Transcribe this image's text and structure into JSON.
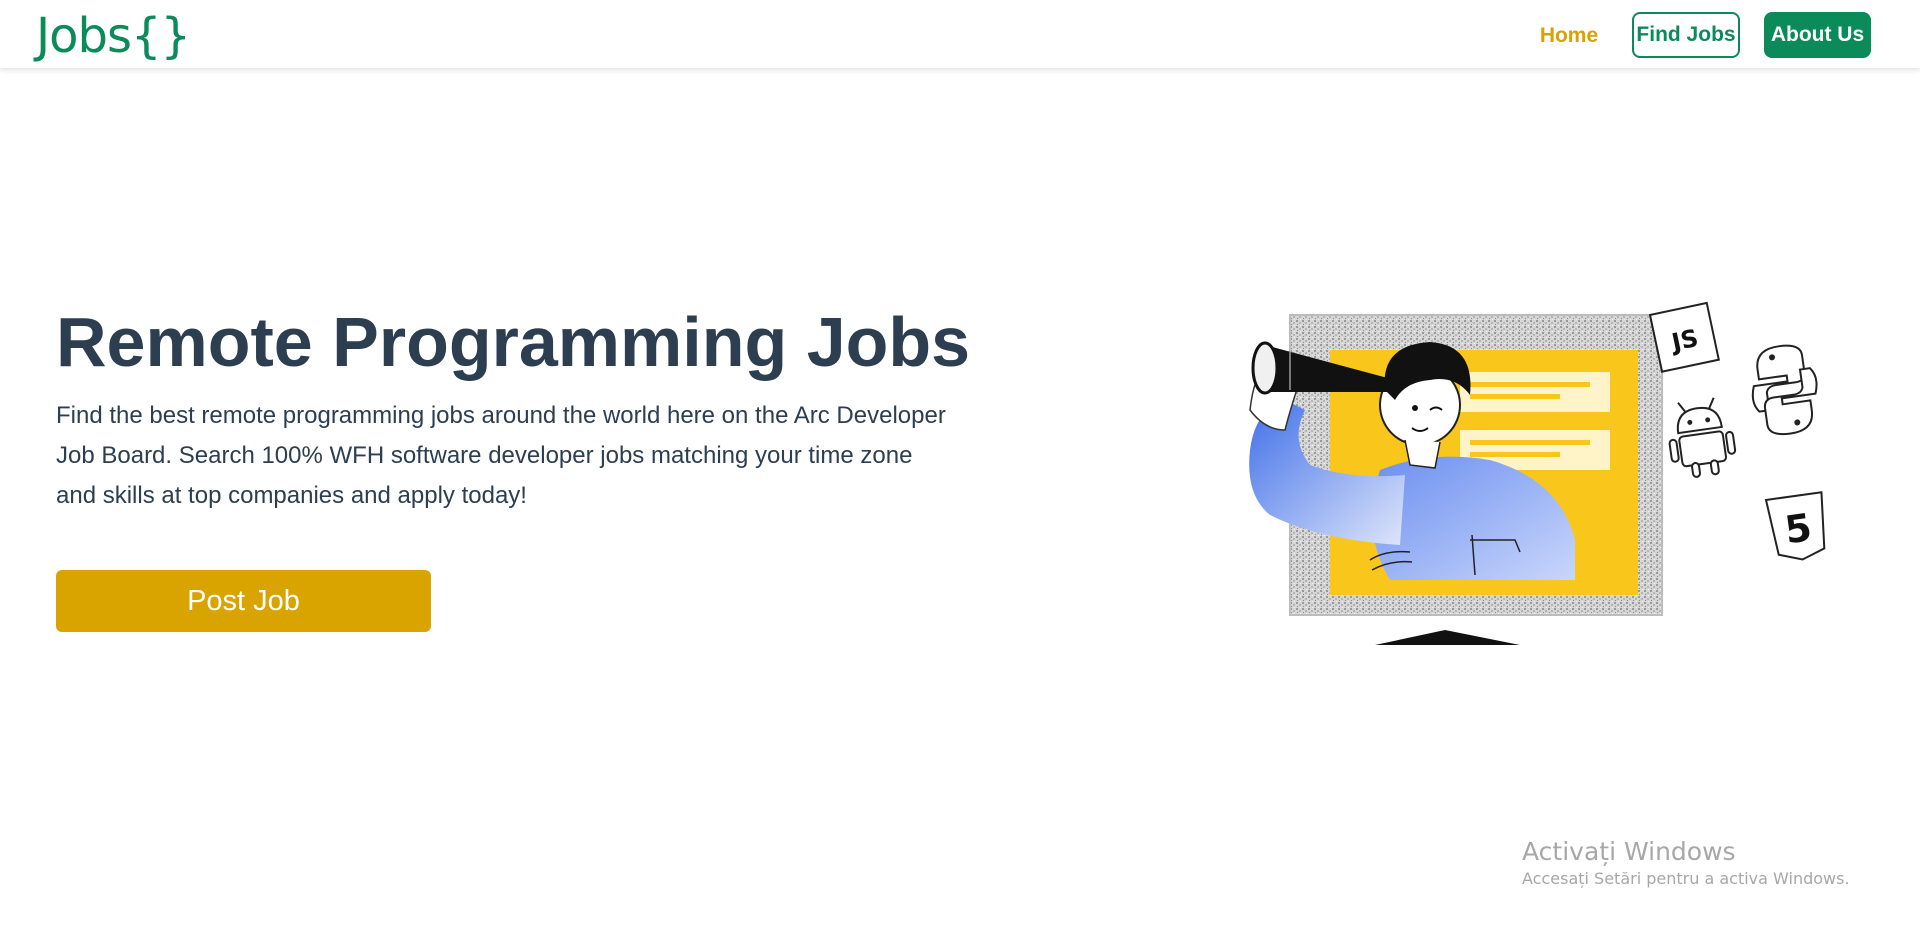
{
  "navbar": {
    "brand": "Jobs{}",
    "home": "Home",
    "find_jobs": "Find Jobs",
    "about_us": "About Us"
  },
  "hero": {
    "title": "Remote Programming Jobs",
    "description": "Find the best remote programming jobs around the world here on the Arc Developer Job Board. Search 100% WFH software developer jobs matching your time zone and skills at top companies and apply today!",
    "post_button": "Post Job"
  },
  "illustration": {
    "badges": [
      "JS",
      "5"
    ],
    "icons": [
      "javascript-badge-icon",
      "python-logo-icon",
      "android-logo-icon",
      "html5-badge-icon"
    ]
  },
  "watermark": {
    "title": "Activați Windows",
    "subtitle": "Accesați Setări pentru a activa Windows."
  },
  "colors": {
    "brand_green": "#0b8a5a",
    "accent_gold": "#d9a300",
    "heading": "#2c3e50",
    "illustration_yellow": "#f9c61c",
    "illustration_blue": "#5b82f0"
  }
}
